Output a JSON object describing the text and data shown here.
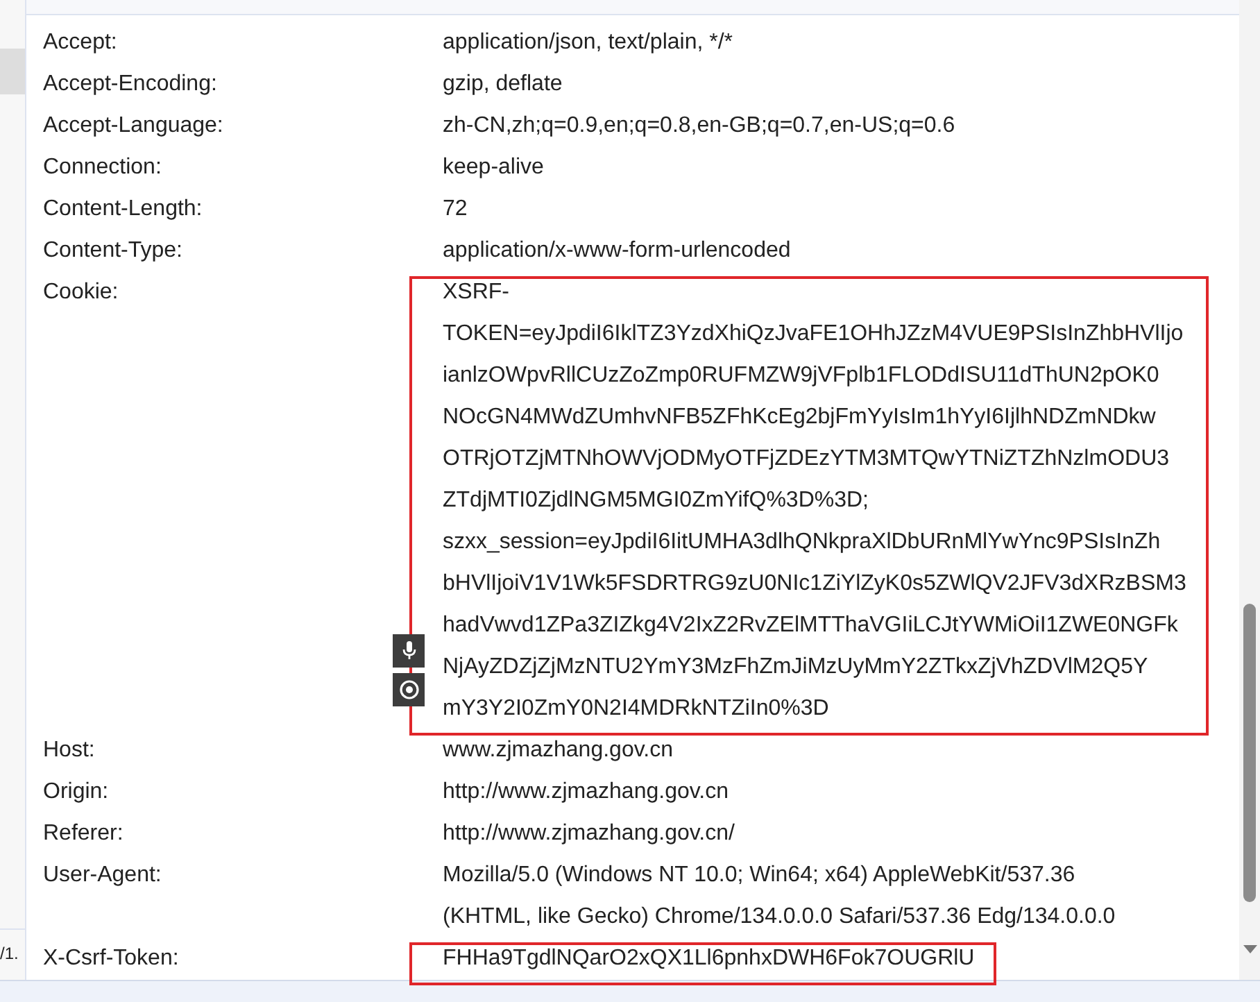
{
  "left_panel": {
    "fragment": "/1."
  },
  "headers": [
    {
      "name": "Accept:",
      "lines": [
        "application/json, text/plain, */*"
      ],
      "highlighted": false
    },
    {
      "name": "Accept-Encoding:",
      "lines": [
        "gzip, deflate"
      ],
      "highlighted": false
    },
    {
      "name": "Accept-Language:",
      "lines": [
        "zh-CN,zh;q=0.9,en;q=0.8,en-GB;q=0.7,en-US;q=0.6"
      ],
      "highlighted": false
    },
    {
      "name": "Connection:",
      "lines": [
        "keep-alive"
      ],
      "highlighted": false
    },
    {
      "name": "Content-Length:",
      "lines": [
        "72"
      ],
      "highlighted": false
    },
    {
      "name": "Content-Type:",
      "lines": [
        "application/x-www-form-urlencoded"
      ],
      "highlighted": false
    },
    {
      "name": "Cookie:",
      "lines": [
        "XSRF-",
        "TOKEN=eyJpdiI6IklTZ3YzdXhiQzJvaFE1OHhJZzM4VUE9PSIsInZhbHVlIjo",
        "ianlzOWpvRllCUzZoZmp0RUFMZW9jVFplb1FLODdISU11dThUN2pOK0",
        "NOcGN4MWdZUmhvNFB5ZFhKcEg2bjFmYyIsIm1hYyI6IjlhNDZmNDkw",
        "OTRjOTZjMTNhOWVjODMyOTFjZDEzYTM3MTQwYTNiZTZhNzlmODU3",
        "ZTdjMTI0ZjdlNGM5MGI0ZmYifQ%3D%3D;",
        "szxx_session=eyJpdiI6IitUMHA3dlhQNkpraXlDbURnMlYwYnc9PSIsInZh",
        "bHVlIjoiV1V1Wk5FSDRTRG9zU0NIc1ZiYlZyK0s5ZWlQV2JFV3dXRzBSM3",
        "hadVwvd1ZPa3ZIZkg4V2IxZ2RvZElMTThaVGIiLCJtYWMiOiI1ZWE0NGFk",
        "NjAyZDZjZjMzNTU2YmY3MzFhZmJiMzUyMmY2ZTkxZjVhZDVlM2Q5Y",
        "mY3Y2I0ZmY0N2I4MDRkNTZiIn0%3D"
      ],
      "highlighted": true
    },
    {
      "name": "Host:",
      "lines": [
        "www.zjmazhang.gov.cn"
      ],
      "highlighted": false
    },
    {
      "name": "Origin:",
      "lines": [
        "http://www.zjmazhang.gov.cn"
      ],
      "highlighted": false
    },
    {
      "name": "Referer:",
      "lines": [
        "http://www.zjmazhang.gov.cn/"
      ],
      "highlighted": false
    },
    {
      "name": "User-Agent:",
      "lines": [
        "Mozilla/5.0 (Windows NT 10.0; Win64; x64) AppleWebKit/537.36",
        "(KHTML, like Gecko) Chrome/134.0.0.0 Safari/537.36 Edg/134.0.0.0"
      ],
      "highlighted": false
    },
    {
      "name": "X-Csrf-Token:",
      "lines": [
        "FHHa9TgdlNQarO2xQX1Ll6pnhxDWH6Fok7OUGRlU"
      ],
      "highlighted": true
    }
  ]
}
